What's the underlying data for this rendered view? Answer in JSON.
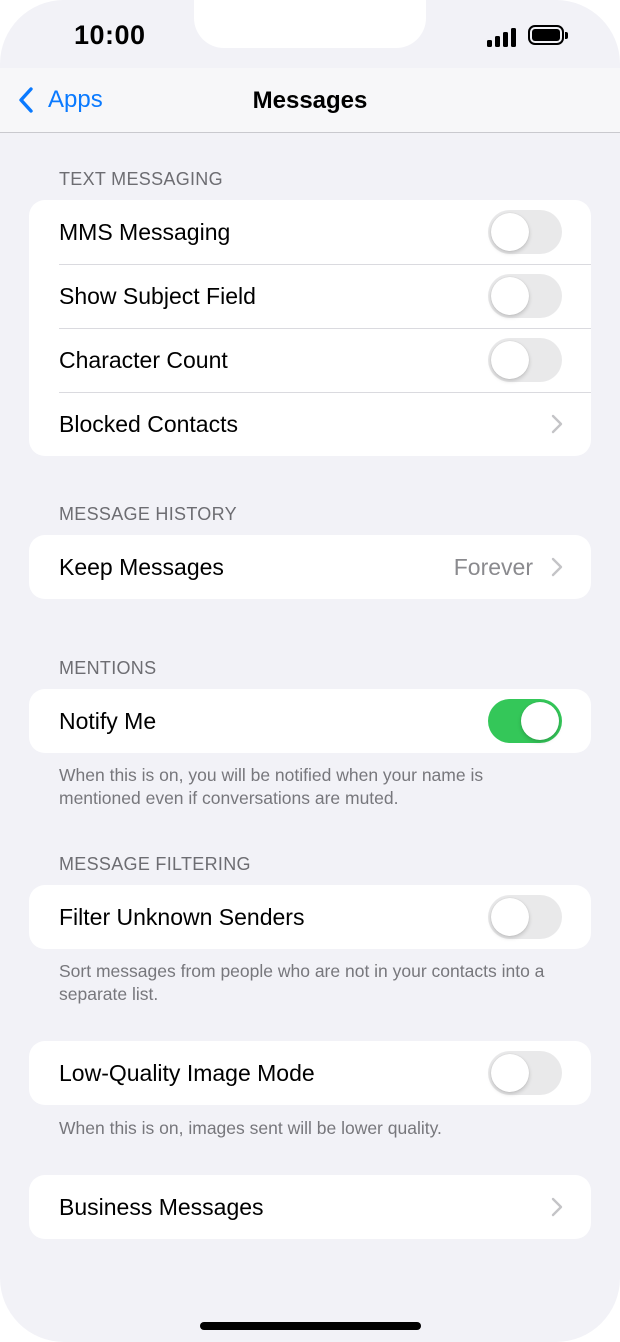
{
  "status_bar": {
    "time": "10:00"
  },
  "nav": {
    "back_label": "Apps",
    "title": "Messages"
  },
  "sections": {
    "text_messaging": {
      "header": "TEXT MESSAGING",
      "mms": {
        "label": "MMS Messaging",
        "on": false
      },
      "subject": {
        "label": "Show Subject Field",
        "on": false
      },
      "char_count": {
        "label": "Character Count",
        "on": false
      },
      "blocked": {
        "label": "Blocked Contacts"
      }
    },
    "message_history": {
      "header": "MESSAGE HISTORY",
      "keep": {
        "label": "Keep Messages",
        "value": "Forever"
      }
    },
    "mentions": {
      "header": "MENTIONS",
      "notify": {
        "label": "Notify Me",
        "on": true
      },
      "footer": "When this is on, you will be notified when your name is mentioned even if conversations are muted."
    },
    "message_filtering": {
      "header": "MESSAGE FILTERING",
      "filter": {
        "label": "Filter Unknown Senders",
        "on": false
      },
      "footer": "Sort messages from people who are not in your contacts into a separate list."
    },
    "low_quality": {
      "mode": {
        "label": "Low-Quality Image Mode",
        "on": false
      },
      "footer": "When this is on, images sent will be lower quality."
    },
    "business": {
      "messages": {
        "label": "Business Messages"
      }
    }
  },
  "colors": {
    "accent": "#0a7aff",
    "toggle_on": "#34c759",
    "toggle_off": "#e9e9ea",
    "background": "#f2f2f7"
  }
}
